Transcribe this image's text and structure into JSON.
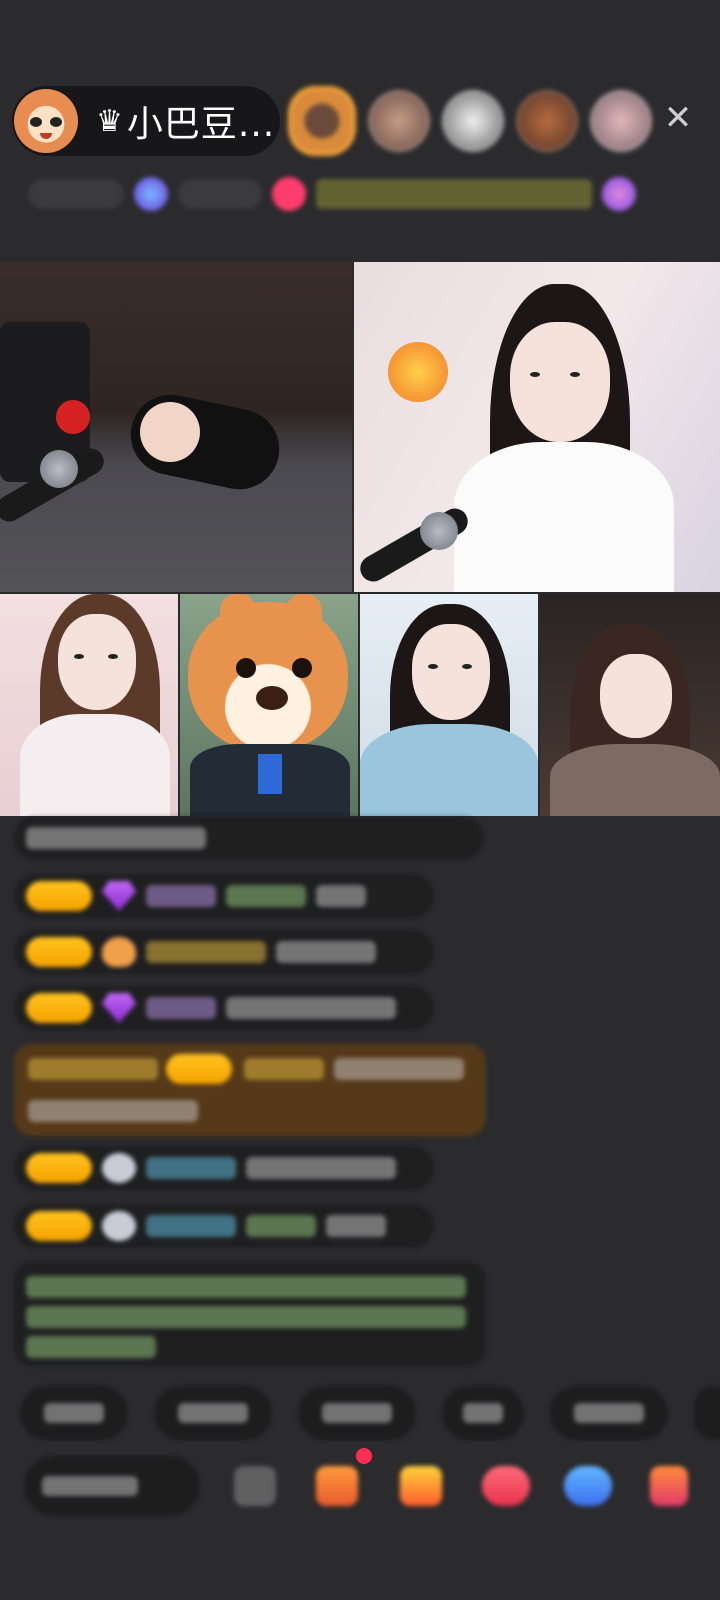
{
  "header": {
    "host_crown_icon": "crown-icon",
    "host_name": "小巴豆...",
    "viewer_count": 5,
    "close_icon": "close-icon"
  },
  "status_bar": {
    "items": 4
  },
  "video_grid": {
    "tiles": 6
  },
  "chat": {
    "lines": 8
  },
  "quick_replies": {
    "count": 6
  },
  "bottom_bar": {
    "icons": [
      "emoji-icon",
      "gift-box-icon",
      "treasure-icon",
      "game-icon",
      "share-icon",
      "more-gifts-icon"
    ],
    "colors": {
      "badge": "#f5a300",
      "accent_red": "#ff2d55",
      "background": "#2b2b2d"
    }
  }
}
